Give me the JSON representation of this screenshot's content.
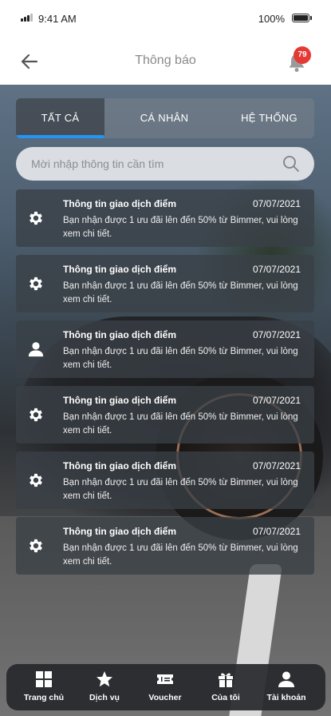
{
  "status_bar": {
    "time": "9:41 AM",
    "battery": "100%"
  },
  "header": {
    "title": "Thông báo",
    "badge_count": "79"
  },
  "tabs": [
    {
      "label": "TẤT CẢ",
      "active": true
    },
    {
      "label": "CÁ NHÂN",
      "active": false
    },
    {
      "label": "HỆ THỐNG",
      "active": false
    }
  ],
  "search": {
    "placeholder": "Mời nhập thông tin cần tìm",
    "value": ""
  },
  "notifications": [
    {
      "icon": "gear-icon",
      "title": "Thông tin giao dịch điểm",
      "date": "07/07/2021",
      "body": "Bạn nhận được 1 ưu đãi lên đến 50% từ Bimmer, vui lòng xem chi tiết."
    },
    {
      "icon": "gear-icon",
      "title": "Thông tin giao dịch điểm",
      "date": "07/07/2021",
      "body": "Bạn nhận được 1 ưu đãi lên đến 50% từ Bimmer, vui lòng xem chi tiết."
    },
    {
      "icon": "user-icon",
      "title": "Thông tin giao dịch điểm",
      "date": "07/07/2021",
      "body": "Bạn nhận được 1 ưu đãi lên đến 50% từ Bimmer, vui lòng xem chi tiết."
    },
    {
      "icon": "gear-icon",
      "title": "Thông tin giao dịch điểm",
      "date": "07/07/2021",
      "body": "Bạn nhận được 1 ưu đãi lên đến 50% từ Bimmer, vui lòng xem chi tiết."
    },
    {
      "icon": "gear-icon",
      "title": "Thông tin giao dịch điểm",
      "date": "07/07/2021",
      "body": "Bạn nhận được 1 ưu đãi lên đến 50% từ Bimmer, vui lòng xem chi tiết."
    },
    {
      "icon": "gear-icon",
      "title": "Thông tin giao dịch điểm",
      "date": "07/07/2021",
      "body": "Bạn nhận được 1 ưu đãi lên đến 50% từ Bimmer, vui lòng xem chi tiết."
    }
  ],
  "bottom_nav": [
    {
      "icon": "grid-icon",
      "label": "Trang chủ"
    },
    {
      "icon": "star-icon",
      "label": "Dịch vụ"
    },
    {
      "icon": "ticket-icon",
      "label": "Voucher"
    },
    {
      "icon": "gift-icon",
      "label": "Của tôi"
    },
    {
      "icon": "user-icon",
      "label": "Tài khoản"
    }
  ],
  "colors": {
    "accent": "#2196f3",
    "badge": "#e53935"
  }
}
